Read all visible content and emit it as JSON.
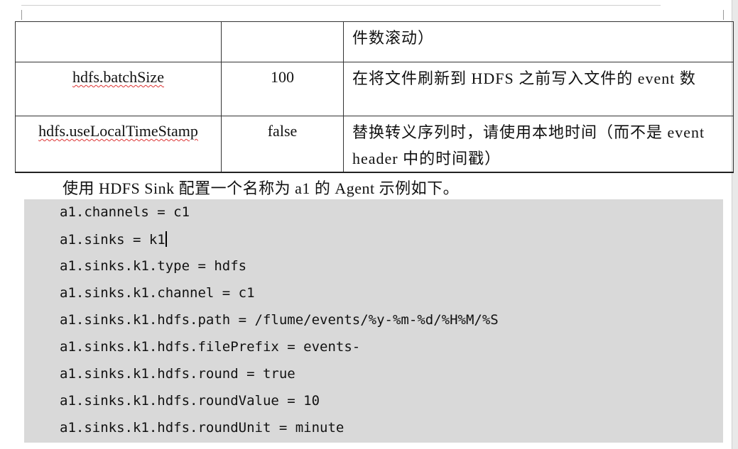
{
  "table": {
    "rows": [
      {
        "name": "",
        "value": "",
        "desc": "件数滚动）"
      },
      {
        "name": "hdfs.batchSize",
        "value": "100",
        "desc": "在将文件刷新到 HDFS 之前写入文件的 event 数"
      },
      {
        "name": "hdfs.useLocalTimeStamp",
        "value": "false",
        "desc": "替换转义序列时，请使用本地时间（而不是 event header 中的时间戳）"
      }
    ]
  },
  "intro": "使用 HDFS Sink 配置一个名称为 a1 的 Agent 示例如下。",
  "code": [
    "a1.channels = c1",
    "a1.sinks = k1",
    "a1.sinks.k1.type = hdfs",
    "a1.sinks.k1.channel = c1",
    "a1.sinks.k1.hdfs.path = /flume/events/%y-%m-%d/%H%M/%S",
    "a1.sinks.k1.hdfs.filePrefix = events-",
    "a1.sinks.k1.hdfs.round = true",
    "a1.sinks.k1.hdfs.roundValue = 10",
    "a1.sinks.k1.hdfs.roundUnit = minute"
  ]
}
